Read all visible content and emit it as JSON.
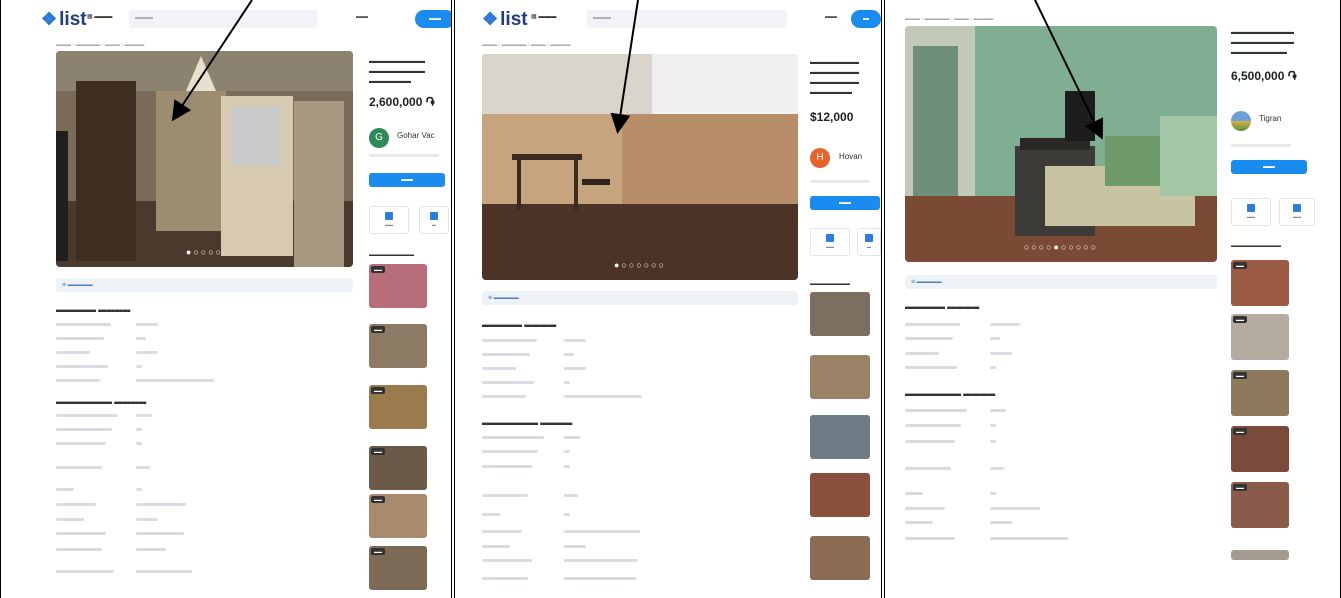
{
  "brand": "list",
  "panels": [
    {
      "price": "2,600,000 ֏",
      "seller_initial": "G",
      "seller_name": "Gohar Vac",
      "seller_color": "#2e8b57",
      "dots": "●○○○○",
      "photo_colors": [
        "#5b4a3e",
        "#8a7a63"
      ]
    },
    {
      "price": "$12,000",
      "seller_initial": "H",
      "seller_name": "Hovan",
      "seller_color": "#e8622c",
      "dots": "●○○○○○○",
      "photo_colors": [
        "#6d5a47",
        "#c7b9a3"
      ]
    },
    {
      "price": "6,500,000 ֏",
      "seller_initial": "",
      "seller_name": "Tigran",
      "seller_color": "#4f7fbf",
      "dots": "○○○○●○○○○○",
      "photo_colors": [
        "#5f8c73",
        "#a8c9b0"
      ]
    }
  ],
  "colors": {
    "accent": "#1a8cf0",
    "brand": "#1e3a8a",
    "frame": "#000000"
  }
}
